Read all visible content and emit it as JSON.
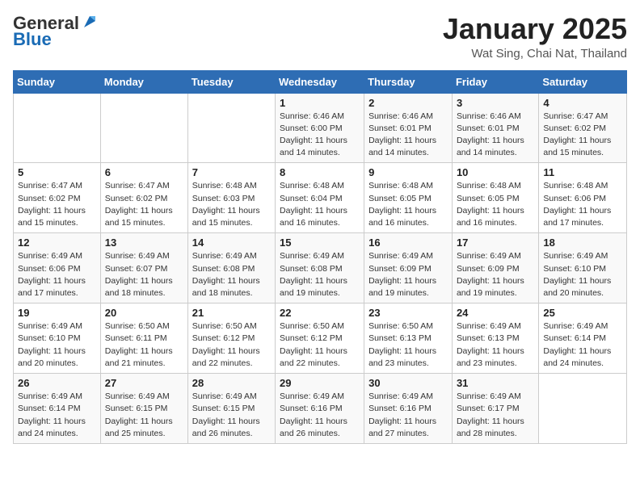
{
  "header": {
    "logo_general": "General",
    "logo_blue": "Blue",
    "month_title": "January 2025",
    "location": "Wat Sing, Chai Nat, Thailand"
  },
  "weekdays": [
    "Sunday",
    "Monday",
    "Tuesday",
    "Wednesday",
    "Thursday",
    "Friday",
    "Saturday"
  ],
  "weeks": [
    [
      {
        "day": "",
        "info": ""
      },
      {
        "day": "",
        "info": ""
      },
      {
        "day": "",
        "info": ""
      },
      {
        "day": "1",
        "info": "Sunrise: 6:46 AM\nSunset: 6:00 PM\nDaylight: 11 hours and 14 minutes."
      },
      {
        "day": "2",
        "info": "Sunrise: 6:46 AM\nSunset: 6:01 PM\nDaylight: 11 hours and 14 minutes."
      },
      {
        "day": "3",
        "info": "Sunrise: 6:46 AM\nSunset: 6:01 PM\nDaylight: 11 hours and 14 minutes."
      },
      {
        "day": "4",
        "info": "Sunrise: 6:47 AM\nSunset: 6:02 PM\nDaylight: 11 hours and 15 minutes."
      }
    ],
    [
      {
        "day": "5",
        "info": "Sunrise: 6:47 AM\nSunset: 6:02 PM\nDaylight: 11 hours and 15 minutes."
      },
      {
        "day": "6",
        "info": "Sunrise: 6:47 AM\nSunset: 6:02 PM\nDaylight: 11 hours and 15 minutes."
      },
      {
        "day": "7",
        "info": "Sunrise: 6:48 AM\nSunset: 6:03 PM\nDaylight: 11 hours and 15 minutes."
      },
      {
        "day": "8",
        "info": "Sunrise: 6:48 AM\nSunset: 6:04 PM\nDaylight: 11 hours and 16 minutes."
      },
      {
        "day": "9",
        "info": "Sunrise: 6:48 AM\nSunset: 6:05 PM\nDaylight: 11 hours and 16 minutes."
      },
      {
        "day": "10",
        "info": "Sunrise: 6:48 AM\nSunset: 6:05 PM\nDaylight: 11 hours and 16 minutes."
      },
      {
        "day": "11",
        "info": "Sunrise: 6:48 AM\nSunset: 6:06 PM\nDaylight: 11 hours and 17 minutes."
      }
    ],
    [
      {
        "day": "12",
        "info": "Sunrise: 6:49 AM\nSunset: 6:06 PM\nDaylight: 11 hours and 17 minutes."
      },
      {
        "day": "13",
        "info": "Sunrise: 6:49 AM\nSunset: 6:07 PM\nDaylight: 11 hours and 18 minutes."
      },
      {
        "day": "14",
        "info": "Sunrise: 6:49 AM\nSunset: 6:08 PM\nDaylight: 11 hours and 18 minutes."
      },
      {
        "day": "15",
        "info": "Sunrise: 6:49 AM\nSunset: 6:08 PM\nDaylight: 11 hours and 19 minutes."
      },
      {
        "day": "16",
        "info": "Sunrise: 6:49 AM\nSunset: 6:09 PM\nDaylight: 11 hours and 19 minutes."
      },
      {
        "day": "17",
        "info": "Sunrise: 6:49 AM\nSunset: 6:09 PM\nDaylight: 11 hours and 19 minutes."
      },
      {
        "day": "18",
        "info": "Sunrise: 6:49 AM\nSunset: 6:10 PM\nDaylight: 11 hours and 20 minutes."
      }
    ],
    [
      {
        "day": "19",
        "info": "Sunrise: 6:49 AM\nSunset: 6:10 PM\nDaylight: 11 hours and 20 minutes."
      },
      {
        "day": "20",
        "info": "Sunrise: 6:50 AM\nSunset: 6:11 PM\nDaylight: 11 hours and 21 minutes."
      },
      {
        "day": "21",
        "info": "Sunrise: 6:50 AM\nSunset: 6:12 PM\nDaylight: 11 hours and 22 minutes."
      },
      {
        "day": "22",
        "info": "Sunrise: 6:50 AM\nSunset: 6:12 PM\nDaylight: 11 hours and 22 minutes."
      },
      {
        "day": "23",
        "info": "Sunrise: 6:50 AM\nSunset: 6:13 PM\nDaylight: 11 hours and 23 minutes."
      },
      {
        "day": "24",
        "info": "Sunrise: 6:49 AM\nSunset: 6:13 PM\nDaylight: 11 hours and 23 minutes."
      },
      {
        "day": "25",
        "info": "Sunrise: 6:49 AM\nSunset: 6:14 PM\nDaylight: 11 hours and 24 minutes."
      }
    ],
    [
      {
        "day": "26",
        "info": "Sunrise: 6:49 AM\nSunset: 6:14 PM\nDaylight: 11 hours and 24 minutes."
      },
      {
        "day": "27",
        "info": "Sunrise: 6:49 AM\nSunset: 6:15 PM\nDaylight: 11 hours and 25 minutes."
      },
      {
        "day": "28",
        "info": "Sunrise: 6:49 AM\nSunset: 6:15 PM\nDaylight: 11 hours and 26 minutes."
      },
      {
        "day": "29",
        "info": "Sunrise: 6:49 AM\nSunset: 6:16 PM\nDaylight: 11 hours and 26 minutes."
      },
      {
        "day": "30",
        "info": "Sunrise: 6:49 AM\nSunset: 6:16 PM\nDaylight: 11 hours and 27 minutes."
      },
      {
        "day": "31",
        "info": "Sunrise: 6:49 AM\nSunset: 6:17 PM\nDaylight: 11 hours and 28 minutes."
      },
      {
        "day": "",
        "info": ""
      }
    ]
  ]
}
